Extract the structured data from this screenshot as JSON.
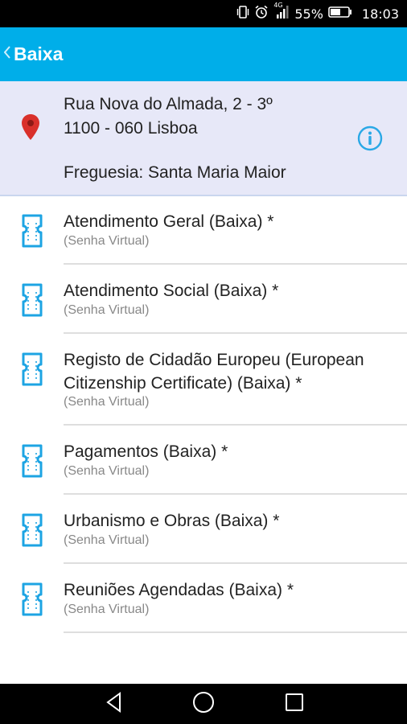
{
  "status_bar": {
    "battery_percent": "55%",
    "time": "18:03",
    "network": "4G",
    "icons": [
      "vibrate-icon",
      "alarm-icon",
      "signal-icon",
      "battery-icon"
    ]
  },
  "app_bar": {
    "title": "Baixa",
    "back_icon": "chevron-left-icon",
    "color": "#00aee9"
  },
  "address": {
    "line1": "Rua Nova do Almada, 2 - 3º",
    "line2": "1100 - 060 Lisboa",
    "parish": "Freguesia: Santa Maria Maior",
    "pin_icon": "location-pin-icon",
    "info_icon": "info-icon",
    "pin_color": "#d9302b",
    "accent_color": "#2aa8e6"
  },
  "services": [
    {
      "title": "Atendimento Geral (Baixa) *",
      "subtitle": "(Senha Virtual)"
    },
    {
      "title": "Atendimento Social (Baixa) *",
      "subtitle": "(Senha Virtual)"
    },
    {
      "title": "Registo de Cidadão Europeu (European Citizenship Certificate) (Baixa) *",
      "subtitle": "(Senha Virtual)"
    },
    {
      "title": "Pagamentos (Baixa) *",
      "subtitle": "(Senha Virtual)"
    },
    {
      "title": "Urbanismo e Obras (Baixa) *",
      "subtitle": "(Senha Virtual)"
    },
    {
      "title": "Reuniões Agendadas (Baixa) *",
      "subtitle": "(Senha Virtual)"
    }
  ],
  "nav_bar": {
    "icons": [
      "back-triangle-icon",
      "home-circle-icon",
      "recents-square-icon"
    ]
  }
}
